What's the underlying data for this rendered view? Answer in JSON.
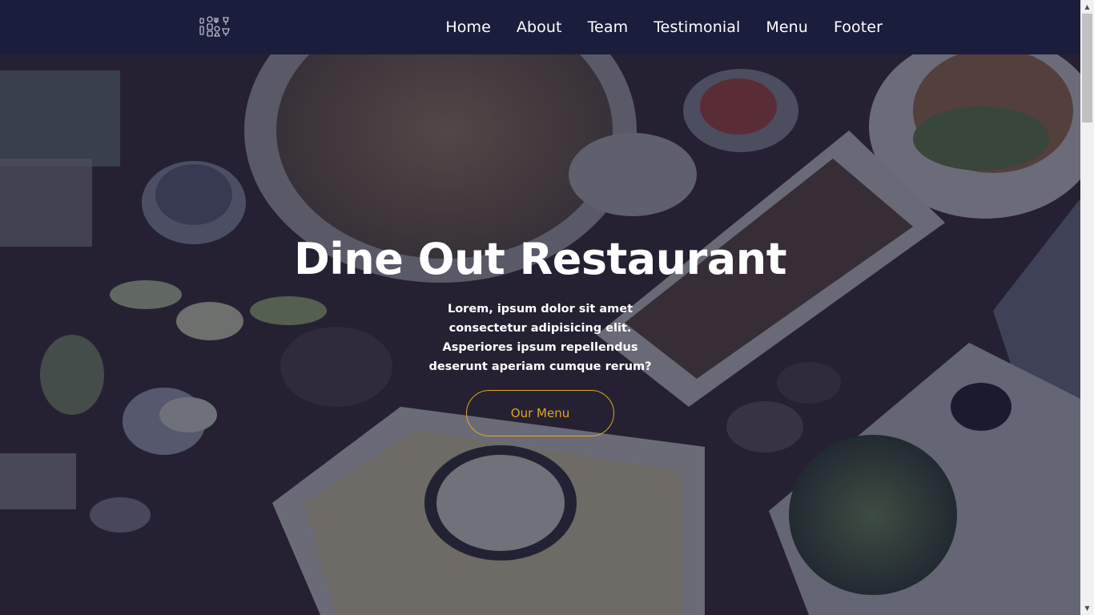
{
  "navbar": {
    "logo_icon": "restaurant-logo-icon",
    "links": [
      {
        "label": "Home"
      },
      {
        "label": "About"
      },
      {
        "label": "Team"
      },
      {
        "label": "Testimonial"
      },
      {
        "label": "Menu"
      },
      {
        "label": "Footer"
      }
    ]
  },
  "hero": {
    "title": "Dine Out Restaurant",
    "text": "Lorem, ipsum dolor sit amet consectetur adipisicing elit. Asperiores ipsum repellendus deserunt aperiam cumque rerum?",
    "button_label": "Our Menu"
  },
  "colors": {
    "navbar_bg": "#1b1d3c",
    "accent": "#e0a526",
    "text": "#ffffff"
  },
  "scrollbar": {
    "up_icon": "scroll-up-arrow-icon",
    "down_icon": "scroll-down-arrow-icon"
  }
}
